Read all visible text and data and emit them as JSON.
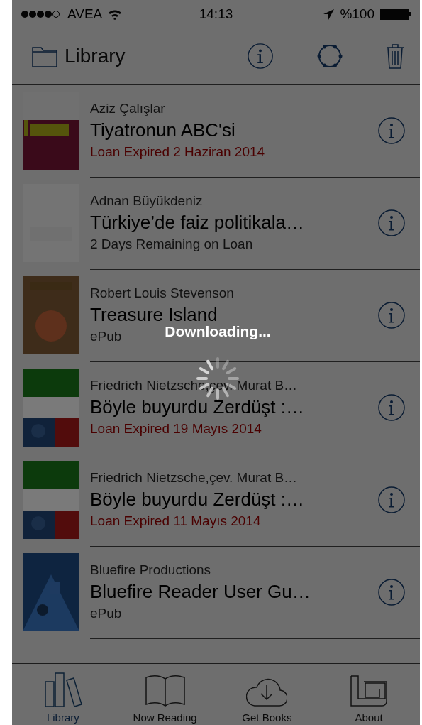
{
  "status_bar": {
    "carrier": "AVEA",
    "time": "14:13",
    "battery": "%100"
  },
  "nav": {
    "title": "Library"
  },
  "books": [
    {
      "author": "Aziz Çalışlar",
      "title": "Tiyatronun ABC'si",
      "status": "Loan Expired 2 Haziran 2014",
      "kind": "expired"
    },
    {
      "author": "Adnan Büyükdeniz",
      "title": "Türkiye’de faiz politikala…",
      "status": "2 Days Remaining on Loan",
      "kind": "info"
    },
    {
      "author": "Robert Louis Stevenson",
      "title": "Treasure Island",
      "status": "ePub",
      "kind": "info"
    },
    {
      "author": "Friedrich Nietzsche,çev. Murat B…",
      "title": "Böyle buyurdu Zerdüşt :…",
      "status": "Loan Expired 19 Mayıs 2014",
      "kind": "expired"
    },
    {
      "author": "Friedrich Nietzsche,çev. Murat B…",
      "title": "Böyle buyurdu Zerdüşt :…",
      "status": "Loan Expired 11 Mayıs 2014",
      "kind": "expired"
    },
    {
      "author": "Bluefire Productions",
      "title": "Bluefire Reader User Gu…",
      "status": "ePub",
      "kind": "info"
    }
  ],
  "hud": {
    "message": "Downloading..."
  },
  "tabs": [
    {
      "label": "Library",
      "selected": true
    },
    {
      "label": "Now Reading",
      "selected": false
    },
    {
      "label": "Get Books",
      "selected": false
    },
    {
      "label": "About",
      "selected": false
    }
  ]
}
